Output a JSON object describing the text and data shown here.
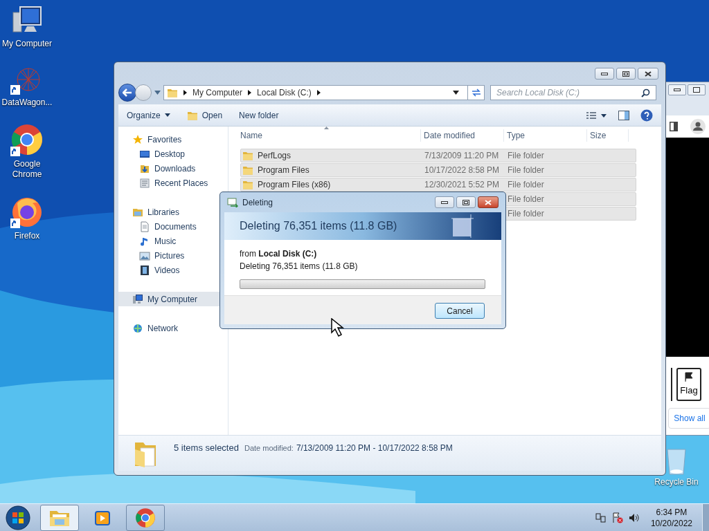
{
  "desktop_icons": [
    {
      "label": "My Computer",
      "kind": "computer",
      "shortcut": false
    },
    {
      "label": "DataWagon...",
      "kind": "network-graph",
      "shortcut": true
    },
    {
      "label": "Google Chrome",
      "kind": "chrome",
      "shortcut": true
    },
    {
      "label": "Firefox",
      "kind": "firefox",
      "shortcut": true
    }
  ],
  "recycle_bin": {
    "label": "Recycle Bin"
  },
  "background_window": {
    "buttons": [
      {
        "label": "Flag"
      }
    ],
    "link": "Show all"
  },
  "explorer": {
    "breadcrumb": [
      "My Computer",
      "Local Disk (C:)"
    ],
    "search": {
      "placeholder": "Search Local Disk (C:)"
    },
    "toolbar": [
      {
        "label": "Organize",
        "kind": "menu"
      },
      {
        "label": "Open",
        "kind": "open"
      },
      {
        "label": "New folder",
        "kind": "plain"
      }
    ],
    "nav": [
      {
        "label": "Favorites",
        "kind": "star",
        "selected": false,
        "children": [
          {
            "label": "Desktop",
            "kind": "desktop",
            "selected": false
          },
          {
            "label": "Downloads",
            "kind": "downloads",
            "selected": false
          },
          {
            "label": "Recent Places",
            "kind": "recent",
            "selected": false
          }
        ]
      },
      {
        "label": "Libraries",
        "kind": "library",
        "selected": false,
        "children": [
          {
            "label": "Documents",
            "kind": "document",
            "selected": false
          },
          {
            "label": "Music",
            "kind": "music",
            "selected": false
          },
          {
            "label": "Pictures",
            "kind": "pictures",
            "selected": false
          },
          {
            "label": "Videos",
            "kind": "videos",
            "selected": false
          }
        ]
      },
      {
        "label": "My Computer",
        "kind": "computer",
        "selected": true
      },
      {
        "label": "Network",
        "kind": "network",
        "selected": false
      }
    ],
    "columns": [
      "Name",
      "Date modified",
      "Type",
      "Size"
    ],
    "rows": [
      {
        "name": "PerfLogs",
        "date": "7/13/2009 11:20 PM",
        "type": "File folder",
        "selected": true
      },
      {
        "name": "Program Files",
        "date": "10/17/2022 8:58 PM",
        "type": "File folder",
        "selected": true
      },
      {
        "name": "Program Files (x86)",
        "date": "12/30/2021 5:52 PM",
        "type": "File folder",
        "selected": true
      },
      {
        "type": "File folder",
        "selected": true
      },
      {
        "type": "File folder",
        "selected": true
      }
    ],
    "status": {
      "count": "5 items selected",
      "date_label": "Date modified:",
      "date_value": "7/13/2009 11:20 PM - 10/17/2022 8:58 PM"
    }
  },
  "dialog": {
    "title": "Deleting",
    "heading": "Deleting 76,351 items (11.8 GB)",
    "source": "from **Local Disk (C:)**",
    "detail": "Deleting 76,351 items (11.8 GB)",
    "progress": {
      "level": 0
    },
    "buttons": [
      "Cancel"
    ]
  },
  "taskbar": {
    "apps": [
      {
        "kind": "explorer",
        "selected": true,
        "running": true
      },
      {
        "kind": "media",
        "selected": false,
        "running": false
      },
      {
        "kind": "chrome",
        "selected": false,
        "running": true
      }
    ],
    "clock": {
      "time": "6:34 PM",
      "date": "10/20/2022"
    }
  }
}
